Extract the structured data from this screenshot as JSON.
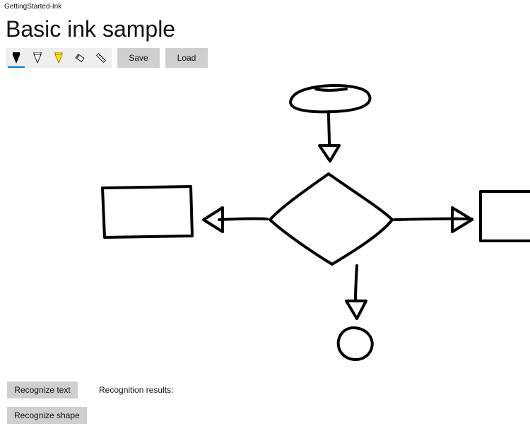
{
  "window": {
    "title": "GettingStarted-Ink"
  },
  "header": {
    "title": "Basic ink sample"
  },
  "toolbar": {
    "tools": [
      {
        "name": "ballpoint-pen",
        "selected": true,
        "fill": "#000000"
      },
      {
        "name": "pencil",
        "selected": false,
        "fill": "#ffffff"
      },
      {
        "name": "highlighter",
        "selected": false,
        "fill": "#ffe600"
      },
      {
        "name": "eraser",
        "selected": false,
        "fill": "#ffffff"
      },
      {
        "name": "ruler",
        "selected": false,
        "fill": "#ffffff"
      }
    ],
    "save_label": "Save",
    "load_label": "Load"
  },
  "footer": {
    "recognize_text_label": "Recognize text",
    "recognize_shape_label": "Recognize shape",
    "results_label": "Recognition results:",
    "results_value": ""
  }
}
